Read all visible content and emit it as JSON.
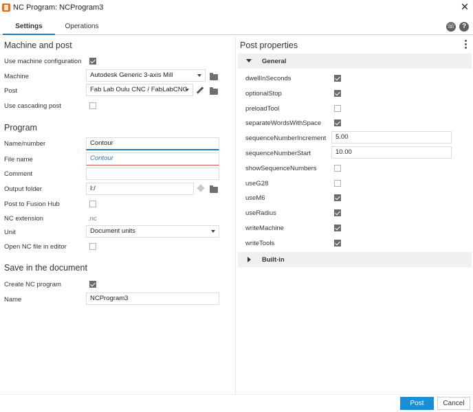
{
  "window": {
    "title": "NC Program: NCProgram3"
  },
  "tabs": [
    {
      "label": "Settings"
    },
    {
      "label": "Operations"
    }
  ],
  "machine_and_post": {
    "heading": "Machine and post",
    "use_machine_configuration": {
      "label": "Use machine configuration",
      "checked": true
    },
    "machine": {
      "label": "Machine",
      "value": "Autodesk Generic 3-axis Mill"
    },
    "post": {
      "label": "Post",
      "value": "Fab Lab Oulu CNC / FabLabCNC"
    },
    "use_cascading_post": {
      "label": "Use cascading post",
      "checked": false
    }
  },
  "program": {
    "heading": "Program",
    "name_number": {
      "label": "Name/number",
      "value": "Contour"
    },
    "file_name": {
      "label": "File name",
      "value": "Contour"
    },
    "comment": {
      "label": "Comment",
      "value": ""
    },
    "output_folder": {
      "label": "Output folder",
      "value": "I:/"
    },
    "post_to_fusion_hub": {
      "label": "Post to Fusion Hub",
      "checked": false
    },
    "nc_extension": {
      "label": "NC extension",
      "value": ".nc"
    },
    "unit": {
      "label": "Unit",
      "value": "Document units"
    },
    "open_nc_file": {
      "label": "Open NC file in editor",
      "checked": false
    }
  },
  "save_in_document": {
    "heading": "Save in the document",
    "create_nc_program": {
      "label": "Create NC program",
      "checked": true
    },
    "name": {
      "label": "Name",
      "value": "NCProgram3"
    }
  },
  "post_properties": {
    "heading": "Post properties",
    "general_label": "General",
    "builtin_label": "Built-in",
    "rows": [
      {
        "label": "dwellInSeconds",
        "type": "checkbox",
        "checked": true
      },
      {
        "label": "optionalStop",
        "type": "checkbox",
        "checked": true
      },
      {
        "label": "preloadTool",
        "type": "checkbox",
        "checked": false
      },
      {
        "label": "separateWordsWithSpace",
        "type": "checkbox",
        "checked": true
      },
      {
        "label": "sequenceNumberIncrement",
        "type": "text",
        "value": "5.00"
      },
      {
        "label": "sequenceNumberStart",
        "type": "text",
        "value": "10.00"
      },
      {
        "label": "showSequenceNumbers",
        "type": "checkbox",
        "checked": false
      },
      {
        "label": "useG28",
        "type": "checkbox",
        "checked": false
      },
      {
        "label": "useM6",
        "type": "checkbox",
        "checked": true
      },
      {
        "label": "useRadius",
        "type": "checkbox",
        "checked": true
      },
      {
        "label": "writeMachine",
        "type": "checkbox",
        "checked": true
      },
      {
        "label": "writeTools",
        "type": "checkbox",
        "checked": true
      }
    ]
  },
  "footer": {
    "post_label": "Post",
    "cancel_label": "Cancel"
  },
  "colors": {
    "accent": "#1a8fd8",
    "tab_underline": "#0f7fbf",
    "error": "#d9534f"
  }
}
